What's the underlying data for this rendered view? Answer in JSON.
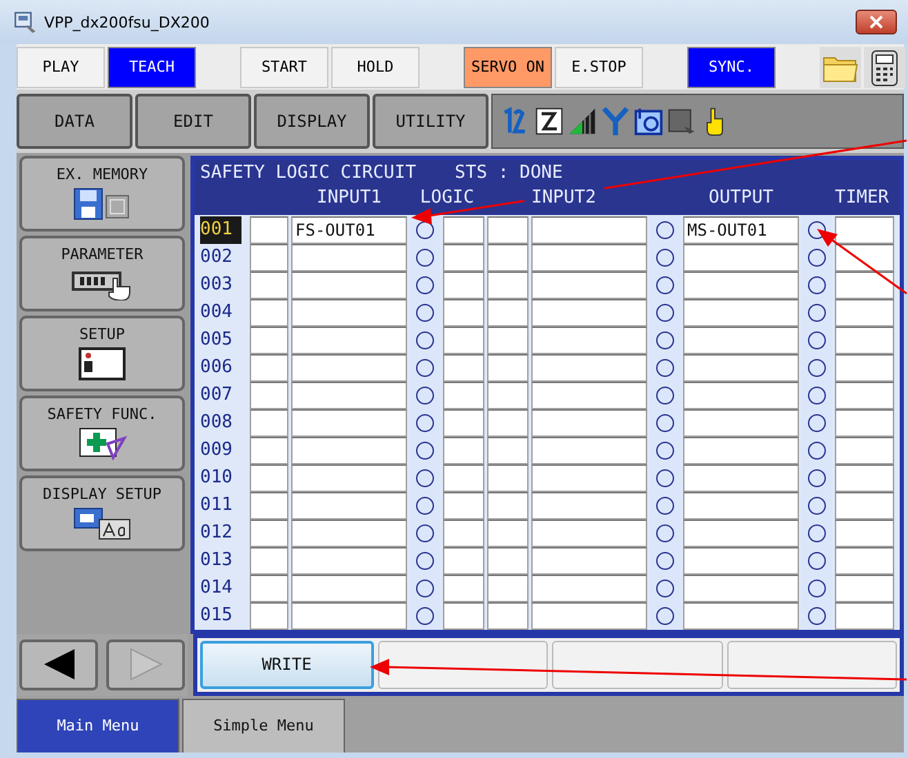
{
  "window": {
    "title": "VPP_dx200fsu_DX200"
  },
  "top_bar": [
    {
      "buttons": [
        {
          "label": "PLAY",
          "on": false
        },
        {
          "label": "TEACH",
          "on": true,
          "color": "#0000ff"
        }
      ]
    },
    {
      "buttons": [
        {
          "label": "START",
          "on": false
        },
        {
          "label": "HOLD",
          "on": false
        }
      ]
    },
    {
      "buttons": [
        {
          "label": "SERVO ON",
          "on": true,
          "color": "#ff9966"
        },
        {
          "label": "E.STOP",
          "on": false
        }
      ]
    },
    {
      "buttons": [
        {
          "label": "SYNC.",
          "on": true,
          "color": "#0000ff"
        }
      ]
    }
  ],
  "menu": [
    "DATA",
    "EDIT",
    "DISPLAY",
    "UTILITY"
  ],
  "side_menu": [
    {
      "label": "EX. MEMORY",
      "kind": "memory"
    },
    {
      "label": "PARAMETER",
      "kind": "parameter"
    },
    {
      "label": "SETUP",
      "kind": "setup"
    },
    {
      "label": "SAFETY FUNC.",
      "kind": "safety"
    },
    {
      "label": "DISPLAY SETUP",
      "kind": "display"
    }
  ],
  "panel": {
    "title": "SAFETY LOGIC CIRCUIT",
    "status": "STS : DONE",
    "columns": [
      "INPUT1",
      "LOGIC",
      "INPUT2",
      "OUTPUT",
      "TIMER"
    ],
    "rows": [
      {
        "no": "001",
        "selected": true,
        "input1": "FS-OUT01",
        "output": "MS-OUT01"
      },
      {
        "no": "002",
        "selected": false
      },
      {
        "no": "003",
        "selected": false
      },
      {
        "no": "004",
        "selected": false
      },
      {
        "no": "005",
        "selected": false
      },
      {
        "no": "006",
        "selected": false
      },
      {
        "no": "007",
        "selected": false
      },
      {
        "no": "008",
        "selected": false
      },
      {
        "no": "009",
        "selected": false
      },
      {
        "no": "010",
        "selected": false
      },
      {
        "no": "011",
        "selected": false
      },
      {
        "no": "012",
        "selected": false
      },
      {
        "no": "013",
        "selected": false
      },
      {
        "no": "014",
        "selected": false
      },
      {
        "no": "015",
        "selected": false
      }
    ]
  },
  "function_buttons": [
    "WRITE"
  ],
  "tabs": [
    {
      "label": "Main Menu",
      "selected": true
    },
    {
      "label": "Simple Menu",
      "selected": false
    }
  ]
}
